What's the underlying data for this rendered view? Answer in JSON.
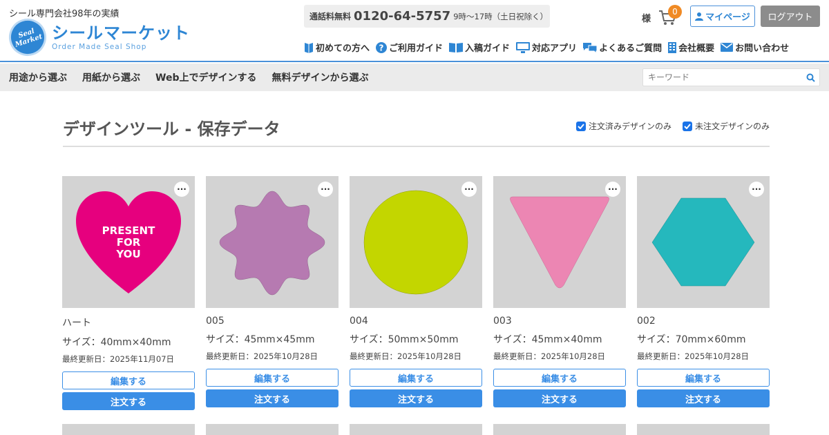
{
  "header": {
    "tagline": "シール専門会社98年の実績",
    "logo": {
      "badge_line1": "Seal",
      "badge_line2": "Market",
      "name": "シールマーケット",
      "sub": "Order Made Seal Shop"
    },
    "phone": {
      "label": "通話料無料",
      "number": "0120-64-5757",
      "hours": "9時〜17時（土日祝除く）"
    },
    "honorific": "様",
    "cart_count": "0",
    "mypage_label": "マイページ",
    "logout_label": "ログアウト",
    "utility_links": [
      {
        "label": "初めての方へ",
        "icon": "book-icon"
      },
      {
        "label": "ご利用ガイド",
        "icon": "question-icon"
      },
      {
        "label": "入稿ガイド",
        "icon": "open-book-icon"
      },
      {
        "label": "対応アプリ",
        "icon": "monitor-icon"
      },
      {
        "label": "よくあるご質問",
        "icon": "chat-icon"
      },
      {
        "label": "会社概要",
        "icon": "building-icon"
      },
      {
        "label": "お問い合わせ",
        "icon": "mail-icon"
      }
    ]
  },
  "nav": {
    "items": [
      "用途から選ぶ",
      "用紙から選ぶ",
      "Web上でデザインする",
      "無料デザインから選ぶ"
    ],
    "search_placeholder": "キーワード"
  },
  "page": {
    "title": "デザインツール - 保存データ",
    "filters": [
      {
        "label": "注文済みデザインのみ",
        "checked": true
      },
      {
        "label": "未注文デザインのみ",
        "checked": true
      }
    ]
  },
  "cards": [
    {
      "name": "ハート",
      "size": "サイズ：40mm×40mm",
      "date": "最終更新日：2025年11月07日",
      "shape": "heart",
      "color": "#e6007e",
      "text_lines": [
        "PRESENT",
        "FOR",
        "YOU"
      ]
    },
    {
      "name": "005",
      "size": "サイズ：45mm×45mm",
      "date": "最終更新日：2025年10月28日",
      "shape": "star-blob",
      "color": "#b67ab1"
    },
    {
      "name": "004",
      "size": "サイズ：50mm×50mm",
      "date": "最終更新日：2025年10月28日",
      "shape": "circle",
      "color": "#c3d600"
    },
    {
      "name": "003",
      "size": "サイズ：45mm×40mm",
      "date": "最終更新日：2025年10月28日",
      "shape": "triangle",
      "color": "#ec86b3"
    },
    {
      "name": "002",
      "size": "サイズ：70mm×60mm",
      "date": "最終更新日：2025年10月28日",
      "shape": "hexagon",
      "color": "#25b8bd"
    }
  ],
  "card_buttons": {
    "edit": "編集する",
    "order": "注文する",
    "more": "···"
  }
}
